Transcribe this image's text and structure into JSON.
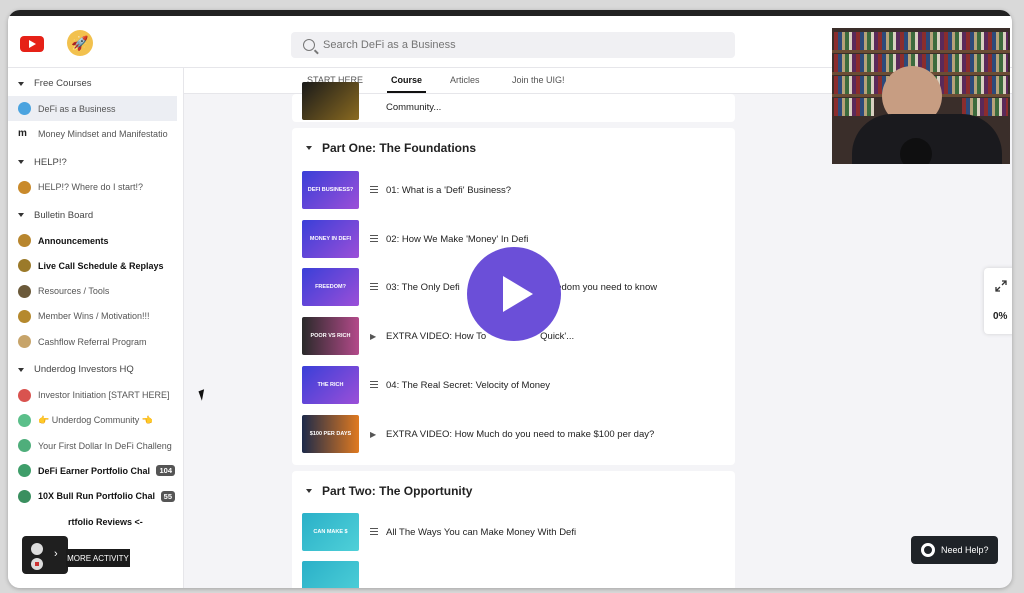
{
  "header": {
    "search_placeholder": "Search DeFi as a Business"
  },
  "tabs": [
    {
      "label": "START HERE"
    },
    {
      "label": "Course"
    },
    {
      "label": "Articles"
    },
    {
      "label": "Join the UIG!"
    }
  ],
  "sidebar": {
    "groups": [
      {
        "title": "Free Courses",
        "items": [
          {
            "label": "DeFi as a Business",
            "active": true
          },
          {
            "label": "Money Mindset and Manifestatio"
          }
        ]
      },
      {
        "title": "HELP!?",
        "items": [
          {
            "label": "HELP!? Where do I start!?"
          }
        ]
      },
      {
        "title": "Bulletin Board",
        "items": [
          {
            "label": "Announcements"
          },
          {
            "label": "Live Call Schedule & Replays"
          },
          {
            "label": "Resources / Tools"
          },
          {
            "label": "Member Wins / Motivation!!!"
          },
          {
            "label": "Cashflow Referral Program"
          }
        ]
      },
      {
        "title": "Underdog Investors HQ",
        "items": [
          {
            "label": "Investor Initiation [START HERE]"
          },
          {
            "label": "👉 Underdog Community 👈"
          },
          {
            "label": "Your First Dollar In DeFi Challeng"
          },
          {
            "label": "DeFi Earner Portfolio Chal",
            "count": "104"
          },
          {
            "label": "10X Bull Run Portfolio Chal",
            "count": "55"
          },
          {
            "label": "rtfolio Reviews <-"
          }
        ]
      }
    ]
  },
  "main": {
    "prev_lesson": "Community...",
    "part_one": {
      "title": "Part One: The Foundations",
      "lessons": [
        {
          "title": "01: What is a 'Defi' Business?",
          "thumb": "DEFI BUSINESS?"
        },
        {
          "title": "02: How We Make 'Money' In Defi",
          "thumb": "MONEY IN DEFI"
        },
        {
          "title": "03: The Only Defi",
          "title_tail": "reedom you need to know",
          "thumb": "FREEDOM?"
        },
        {
          "title": "EXTRA VIDEO: How To",
          "title_tail": "Quick'...",
          "thumb": "POOR VS RICH"
        },
        {
          "title": "04: The Real Secret: Velocity of Money",
          "thumb": "THE RICH"
        },
        {
          "title": "EXTRA VIDEO: How Much do you need to make $100 per day?",
          "thumb": "$100 PER DAYS"
        }
      ]
    },
    "part_two": {
      "title": "Part Two: The Opportunity",
      "lessons": [
        {
          "title": "All The Ways You can Make Money With Defi",
          "thumb": "CAN MAKE $"
        }
      ]
    }
  },
  "widgets": {
    "progress_label": "0%",
    "need_help": "Need Help?",
    "more_activity": "MORE ACTIVITY"
  }
}
